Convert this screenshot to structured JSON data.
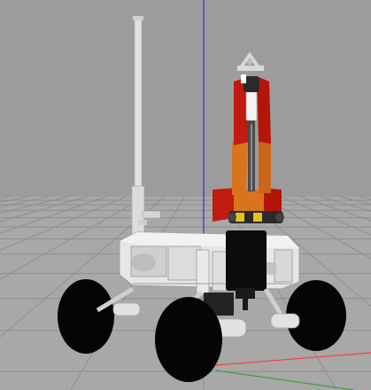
{
  "viewport": {
    "kind": "3d-simulation-view",
    "scene": "rover-with-robotic-arm",
    "colors": {
      "sky": "#9c9c9c",
      "ground": "#a8a8a8",
      "grid_line": "#8e8e8e",
      "axis_z": "#2a2aff",
      "axis_x": "#ff3a3a",
      "axis_y": "#3aa03a",
      "chassis": "#e6e6e6",
      "chassis_shadow": "#bdbdbd",
      "arm_red": "#c21a10",
      "arm_orange": "#d8741c",
      "arm_dark": "#3a3a3a",
      "wheel": "#050505",
      "wheel_hub": "#1a1a1a",
      "mast": "#e2e2e2",
      "gripper": "#d9d9d9",
      "accent_yellow": "#e3c31c",
      "box_black": "#0c0c0c"
    }
  }
}
